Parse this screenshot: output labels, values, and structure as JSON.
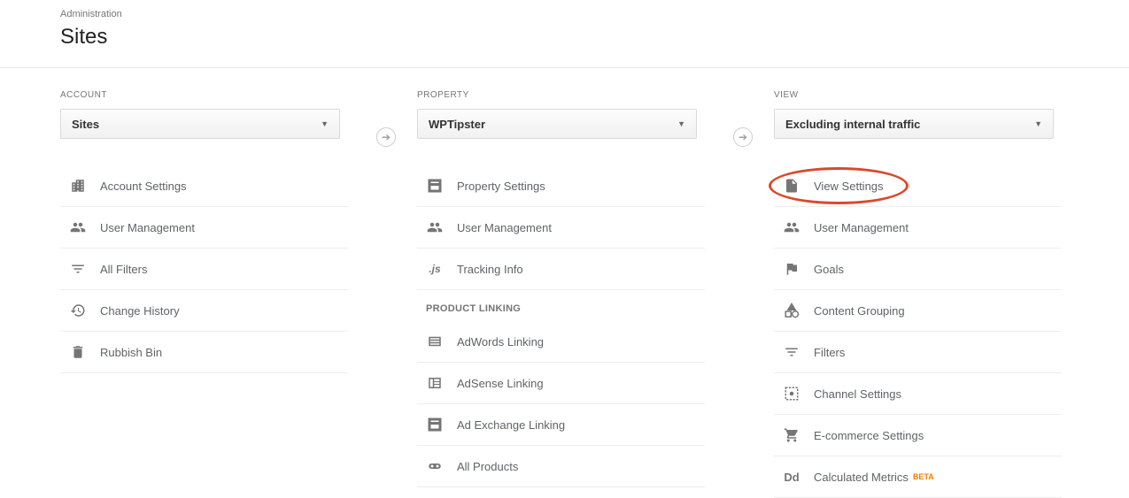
{
  "header": {
    "breadcrumb": "Administration",
    "title": "Sites"
  },
  "columns": {
    "account": {
      "label": "ACCOUNT",
      "selected": "Sites",
      "items": [
        {
          "icon": "building-icon",
          "label": "Account Settings"
        },
        {
          "icon": "users-icon",
          "label": "User Management"
        },
        {
          "icon": "funnel-icon",
          "label": "All Filters"
        },
        {
          "icon": "history-icon",
          "label": "Change History"
        },
        {
          "icon": "trash-icon",
          "label": "Rubbish Bin"
        }
      ]
    },
    "property": {
      "label": "PROPERTY",
      "selected": "WPTipster",
      "items": [
        {
          "icon": "layout-icon",
          "label": "Property Settings"
        },
        {
          "icon": "users-icon",
          "label": "User Management"
        },
        {
          "icon": "js-icon",
          "label": "Tracking Info"
        }
      ],
      "section_label": "PRODUCT LINKING",
      "linking_items": [
        {
          "icon": "adwords-icon",
          "label": "AdWords Linking"
        },
        {
          "icon": "adsense-icon",
          "label": "AdSense Linking"
        },
        {
          "icon": "layout-icon",
          "label": "Ad Exchange Linking"
        },
        {
          "icon": "link-icon",
          "label": "All Products"
        }
      ]
    },
    "view": {
      "label": "VIEW",
      "selected": "Excluding internal traffic",
      "items": [
        {
          "icon": "file-icon",
          "label": "View Settings",
          "highlighted": true
        },
        {
          "icon": "users-icon",
          "label": "User Management"
        },
        {
          "icon": "flag-icon",
          "label": "Goals"
        },
        {
          "icon": "grouping-icon",
          "label": "Content Grouping"
        },
        {
          "icon": "funnel-icon",
          "label": "Filters"
        },
        {
          "icon": "channel-icon",
          "label": "Channel Settings"
        },
        {
          "icon": "cart-icon",
          "label": "E-commerce Settings"
        },
        {
          "icon": "dd-icon",
          "label": "Calculated Metrics",
          "beta": "BETA"
        }
      ]
    }
  }
}
